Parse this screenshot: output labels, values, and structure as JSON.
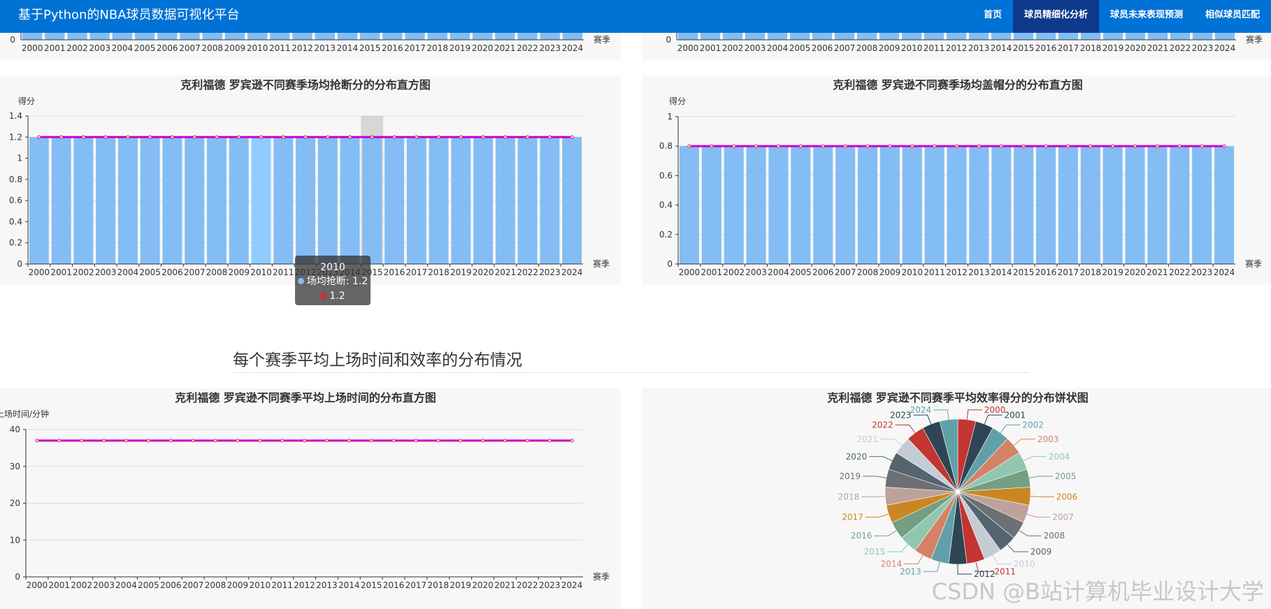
{
  "navbar": {
    "brand": "基于Python的NBA球员数据可视化平台",
    "items": [
      {
        "label": "首页",
        "active": false
      },
      {
        "label": "球员精细化分析",
        "active": true
      },
      {
        "label": "球员未来表现预测",
        "active": false
      },
      {
        "label": "相似球员匹配",
        "active": false
      }
    ]
  },
  "colors": {
    "navbar": "#0072d6",
    "nav_active": "#0d3a8d",
    "bar": "#83bdf3",
    "bar_hover": "#8fccff",
    "line": "#cc00cc",
    "line_point": "#f2d27a"
  },
  "tooltip": {
    "title": "2010",
    "series_label": "场均抢断: 1.2",
    "value_label": "1.2"
  },
  "section": {
    "title": "每个赛季平均上场时间和效率的分布情况"
  },
  "watermark": "CSDN @B站计算机毕业设计大学",
  "chart_data": [
    {
      "type": "bar",
      "title": "",
      "categories": [
        "2000",
        "2001",
        "2002",
        "2003",
        "2004",
        "2005",
        "2006",
        "2007",
        "2008",
        "2009",
        "2010",
        "2011",
        "2012",
        "2013",
        "2014",
        "2015",
        "2016",
        "2017",
        "2018",
        "2019",
        "2020",
        "2021",
        "2022",
        "2023",
        "2024"
      ],
      "xlabel": "赛季",
      "ylabel": "",
      "yticks": [
        0
      ]
    },
    {
      "type": "bar",
      "title": "",
      "categories": [
        "2000",
        "2001",
        "2002",
        "2003",
        "2004",
        "2005",
        "2006",
        "2007",
        "2008",
        "2009",
        "2010",
        "2011",
        "2012",
        "2013",
        "2014",
        "2015",
        "2016",
        "2017",
        "2018",
        "2019",
        "2020",
        "2021",
        "2022",
        "2023",
        "2024"
      ],
      "xlabel": "赛季",
      "ylabel": "",
      "yticks": [
        0
      ]
    },
    {
      "type": "bar",
      "title": "克利福德 罗宾逊不同赛季场均抢断分的分布直方图",
      "categories": [
        "2000",
        "2001",
        "2002",
        "2003",
        "2004",
        "2005",
        "2006",
        "2007",
        "2008",
        "2009",
        "2010",
        "2011",
        "2012",
        "2013",
        "2014",
        "2015",
        "2016",
        "2017",
        "2018",
        "2019",
        "2020",
        "2021",
        "2022",
        "2023",
        "2024"
      ],
      "series": [
        {
          "name": "场均抢断",
          "kind": "bar",
          "values": [
            1.2,
            1.2,
            1.2,
            1.2,
            1.2,
            1.2,
            1.2,
            1.2,
            1.2,
            1.2,
            1.2,
            1.2,
            1.2,
            1.2,
            1.2,
            1.2,
            1.2,
            1.2,
            1.2,
            1.2,
            1.2,
            1.2,
            1.2,
            1.2,
            1.2
          ]
        },
        {
          "kind": "line",
          "values": [
            1.2,
            1.2,
            1.2,
            1.2,
            1.2,
            1.2,
            1.2,
            1.2,
            1.2,
            1.2,
            1.2,
            1.2,
            1.2,
            1.2,
            1.2,
            1.2,
            1.2,
            1.2,
            1.2,
            1.2,
            1.2,
            1.2,
            1.2,
            1.2,
            1.2
          ]
        }
      ],
      "xlabel": "赛季",
      "ylabel": "得分",
      "ylim": [
        0,
        1.4
      ],
      "yticks": [
        0,
        0.2,
        0.4,
        0.6,
        0.8,
        1,
        1.2,
        1.4
      ],
      "hover_index": 10,
      "shadow_index": 15
    },
    {
      "type": "bar",
      "title": "克利福德 罗宾逊不同赛季场均盖帽分的分布直方图",
      "categories": [
        "2000",
        "2001",
        "2002",
        "2003",
        "2004",
        "2005",
        "2006",
        "2007",
        "2008",
        "2009",
        "2010",
        "2011",
        "2012",
        "2013",
        "2014",
        "2015",
        "2016",
        "2017",
        "2018",
        "2019",
        "2020",
        "2021",
        "2022",
        "2023",
        "2024"
      ],
      "series": [
        {
          "name": "场均盖帽",
          "kind": "bar",
          "values": [
            0.8,
            0.8,
            0.8,
            0.8,
            0.8,
            0.8,
            0.8,
            0.8,
            0.8,
            0.8,
            0.8,
            0.8,
            0.8,
            0.8,
            0.8,
            0.8,
            0.8,
            0.8,
            0.8,
            0.8,
            0.8,
            0.8,
            0.8,
            0.8,
            0.8
          ]
        },
        {
          "kind": "line",
          "values": [
            0.8,
            0.8,
            0.8,
            0.8,
            0.8,
            0.8,
            0.8,
            0.8,
            0.8,
            0.8,
            0.8,
            0.8,
            0.8,
            0.8,
            0.8,
            0.8,
            0.8,
            0.8,
            0.8,
            0.8,
            0.8,
            0.8,
            0.8,
            0.8,
            0.8
          ]
        }
      ],
      "xlabel": "赛季",
      "ylabel": "得分",
      "ylim": [
        0,
        1
      ],
      "yticks": [
        0,
        0.2,
        0.4,
        0.6,
        0.8,
        1
      ]
    },
    {
      "type": "line",
      "title": "克利福德 罗宾逊不同赛季平均上场时间的分布直方图",
      "categories": [
        "2000",
        "2001",
        "2002",
        "2003",
        "2004",
        "2005",
        "2006",
        "2007",
        "2008",
        "2009",
        "2010",
        "2011",
        "2012",
        "2013",
        "2014",
        "2015",
        "2016",
        "2017",
        "2018",
        "2019",
        "2020",
        "2021",
        "2022",
        "2023",
        "2024"
      ],
      "series": [
        {
          "kind": "line",
          "values": [
            37,
            37,
            37,
            37,
            37,
            37,
            37,
            37,
            37,
            37,
            37,
            37,
            37,
            37,
            37,
            37,
            37,
            37,
            37,
            37,
            37,
            37,
            37,
            37,
            37
          ]
        }
      ],
      "xlabel": "赛季",
      "ylabel": "上场时间/分钟",
      "ylim": [
        0,
        40
      ],
      "yticks": [
        0,
        10,
        20,
        30,
        40
      ]
    },
    {
      "type": "pie",
      "title": "克利福德 罗宾逊不同赛季平均效率得分的分布饼状图",
      "labels": [
        "2000",
        "2001",
        "2002",
        "2003",
        "2004",
        "2005",
        "2006",
        "2007",
        "2008",
        "2009",
        "2010",
        "2011",
        "2012",
        "2013",
        "2014",
        "2015",
        "2016",
        "2017",
        "2018",
        "2019",
        "2020",
        "2021",
        "2022",
        "2023",
        "2024"
      ],
      "values": [
        1,
        1,
        1,
        1,
        1,
        1,
        1,
        1,
        1,
        1,
        1,
        1,
        1,
        1,
        1,
        1,
        1,
        1,
        1,
        1,
        1,
        1,
        1,
        1,
        1
      ],
      "colors": [
        "#c23531",
        "#2f4554",
        "#61a0a8",
        "#d48265",
        "#91c7ae",
        "#749f83",
        "#ca8622",
        "#bda29a",
        "#6e7074",
        "#546570",
        "#c4ccd3",
        "#c23531",
        "#2f4554",
        "#61a0a8",
        "#d48265",
        "#91c7ae",
        "#749f83",
        "#ca8622",
        "#bda29a",
        "#6e7074",
        "#546570",
        "#c4ccd3",
        "#c23531",
        "#2f4554",
        "#61a0a8"
      ]
    }
  ]
}
